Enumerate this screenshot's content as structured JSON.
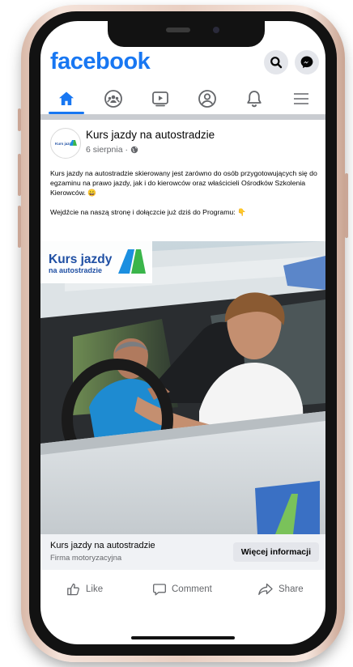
{
  "app": {
    "logo": "facebook",
    "colors": {
      "brand": "#1877f2",
      "text": "#050505",
      "muted": "#65676b"
    }
  },
  "header": {
    "icons": [
      "search-icon",
      "messenger-icon"
    ]
  },
  "nav": {
    "items": [
      "home-icon",
      "groups-icon",
      "watch-icon",
      "profile-icon",
      "notifications-icon",
      "menu-icon"
    ],
    "active": "home-icon"
  },
  "post": {
    "page_name": "Kurs jazdy na autostradzie",
    "date": "6 sierpnia ·",
    "text_paragraphs": [
      "Kurs jazdy na autostradzie skierowany jest zarówno do osób przygotowujących się do egzaminu na prawo jazdy, jak i do kierowców oraz właścicieli Ośrodków Szkolenia Kierowców. 😀",
      "Wejdźcie na naszą stronę i dołączcie już dziś do Programu: 👇"
    ],
    "image_logo": {
      "line1": "Kurs jazdy",
      "line2": "na autostradzie"
    },
    "avatar_logo_text": "Kurs jazdy"
  },
  "cta": {
    "name": "Kurs jazdy na autostradzie",
    "category": "Firma motoryzacyjna",
    "button_label": "Więcej informacji"
  },
  "actions": {
    "like": "Like",
    "comment": "Comment",
    "share": "Share"
  }
}
